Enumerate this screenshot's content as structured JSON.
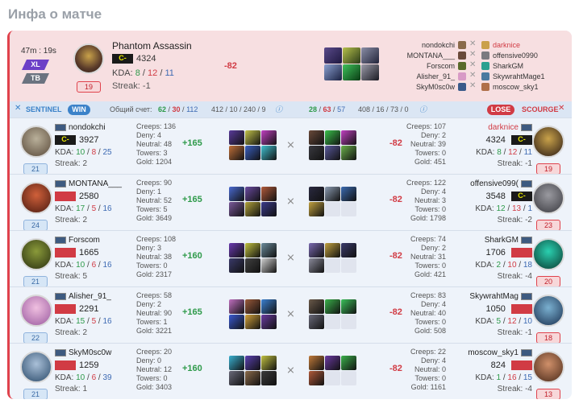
{
  "page": {
    "title": "Инфа о матче"
  },
  "match": {
    "duration": "47m : 19s",
    "badge_size": "XL",
    "badge_mode": "TB",
    "mvp": {
      "hero": "Phantom Assassin",
      "rank": "C-",
      "points": "4324",
      "kda_label": "KDA:",
      "kills": "8",
      "deaths": "12",
      "assists": "11",
      "streak": "Streak: -1",
      "level": "19",
      "delta": "-82"
    },
    "left_list": [
      "nondokchi",
      "MONTANA___",
      "Forscom",
      "Alisher_91_",
      "SkyM0sc0w"
    ],
    "right_list": [
      "darknice",
      "offensive0990",
      "SharkGM",
      "SkywrahtMage1",
      "moscow_sky1"
    ],
    "sentinel_label": "SENTINEL",
    "win_label": "WIN",
    "lose_label": "LOSE",
    "scourge_label": "SCOURGE",
    "score_label": "Общий счет:",
    "left_score": {
      "k": "62",
      "d": "30",
      "a": "112",
      "rest": "412 / 10 / 240 / 9"
    },
    "right_score": {
      "k": "28",
      "d": "63",
      "a": "57",
      "rest": "408 / 16 / 73 / 0"
    }
  },
  "rows": [
    {
      "left": {
        "name": "nondokchi",
        "rank": "C-",
        "points": "3927",
        "kills": "10",
        "deaths": "8",
        "assists": "25",
        "streak": "Streak: 2",
        "level": "21",
        "creeps": "Creeps: 136",
        "deny": "Deny: 4",
        "neutral": "Neutral: 48",
        "towers": "Towers: 3",
        "gold": "Gold: 1204",
        "delta": "+165"
      },
      "right": {
        "name": "darknice",
        "rank": "C-",
        "points": "4324",
        "kills": "8",
        "deaths": "12",
        "assists": "11",
        "streak": "Streak: -1",
        "level": "19",
        "creeps": "Creeps: 107",
        "deny": "Deny: 2",
        "neutral": "Neutral: 39",
        "towers": "Towers: 0",
        "gold": "Gold: 451",
        "delta": "-82"
      }
    },
    {
      "left": {
        "name": "MONTANA___",
        "rank": "",
        "points": "2580",
        "kills": "17",
        "deaths": "5",
        "assists": "16",
        "streak": "Streak: 2",
        "level": "24",
        "creeps": "Creeps: 90",
        "deny": "Deny: 1",
        "neutral": "Neutral: 52",
        "towers": "Towers: 5",
        "gold": "Gold: 3649",
        "delta": "+165"
      },
      "right": {
        "name": "offensive099(",
        "rank": "C-",
        "points": "3548",
        "kills": "12",
        "deaths": "13",
        "assists": "1",
        "streak": "Streak: -2",
        "level": "23",
        "creeps": "Creeps: 122",
        "deny": "Deny: 4",
        "neutral": "Neutral: 3",
        "towers": "Towers: 0",
        "gold": "Gold: 1798",
        "delta": "-82"
      }
    },
    {
      "left": {
        "name": "Forscom",
        "rank": "",
        "points": "1665",
        "kills": "10",
        "deaths": "6",
        "assists": "16",
        "streak": "Streak: 5",
        "level": "21",
        "creeps": "Creeps: 108",
        "deny": "Deny: 3",
        "neutral": "Neutral: 38",
        "towers": "Towers: 0",
        "gold": "Gold: 2317",
        "delta": "+160"
      },
      "right": {
        "name": "SharkGM",
        "rank": "",
        "points": "1706",
        "kills": "2",
        "deaths": "10",
        "assists": "18",
        "streak": "Streak: -4",
        "level": "20",
        "creeps": "Creeps: 74",
        "deny": "Deny: 2",
        "neutral": "Neutral: 31",
        "towers": "Towers: 0",
        "gold": "Gold: 421",
        "delta": "-82"
      }
    },
    {
      "left": {
        "name": "Alisher_91_",
        "rank": "",
        "points": "2291",
        "kills": "15",
        "deaths": "5",
        "assists": "16",
        "streak": "Streak: 2",
        "level": "22",
        "creeps": "Creeps: 58",
        "deny": "Deny: 2",
        "neutral": "Neutral: 90",
        "towers": "Towers: 1",
        "gold": "Gold: 3221",
        "delta": "+165"
      },
      "right": {
        "name": "SkywrahtMag",
        "rank": "",
        "points": "1050",
        "kills": "5",
        "deaths": "12",
        "assists": "10",
        "streak": "Streak: -1",
        "level": "18",
        "creeps": "Creeps: 83",
        "deny": "Deny: 4",
        "neutral": "Neutral: 40",
        "towers": "Towers: 0",
        "gold": "Gold: 508",
        "delta": "-82"
      }
    },
    {
      "left": {
        "name": "SkyM0sc0w",
        "rank": "",
        "points": "1259",
        "kills": "10",
        "deaths": "6",
        "assists": "39",
        "streak": "Streak: 1",
        "level": "21",
        "creeps": "Creeps: 20",
        "deny": "Deny: 0",
        "neutral": "Neutral: 12",
        "towers": "Towers: 0",
        "gold": "Gold: 3403",
        "delta": "+160"
      },
      "right": {
        "name": "moscow_sky1",
        "rank": "",
        "points": "824",
        "kills": "1",
        "deaths": "16",
        "assists": "15",
        "streak": "Streak: -4",
        "level": "13",
        "creeps": "Creeps: 22",
        "deny": "Deny: 4",
        "neutral": "Neutral: 0",
        "towers": "Towers: 0",
        "gold": "Gold: 1161",
        "delta": "-82"
      }
    }
  ],
  "colors": {
    "accent_red": "#e0424c",
    "win_blue": "#3b82c9",
    "kill_green": "#2e9a4a"
  }
}
